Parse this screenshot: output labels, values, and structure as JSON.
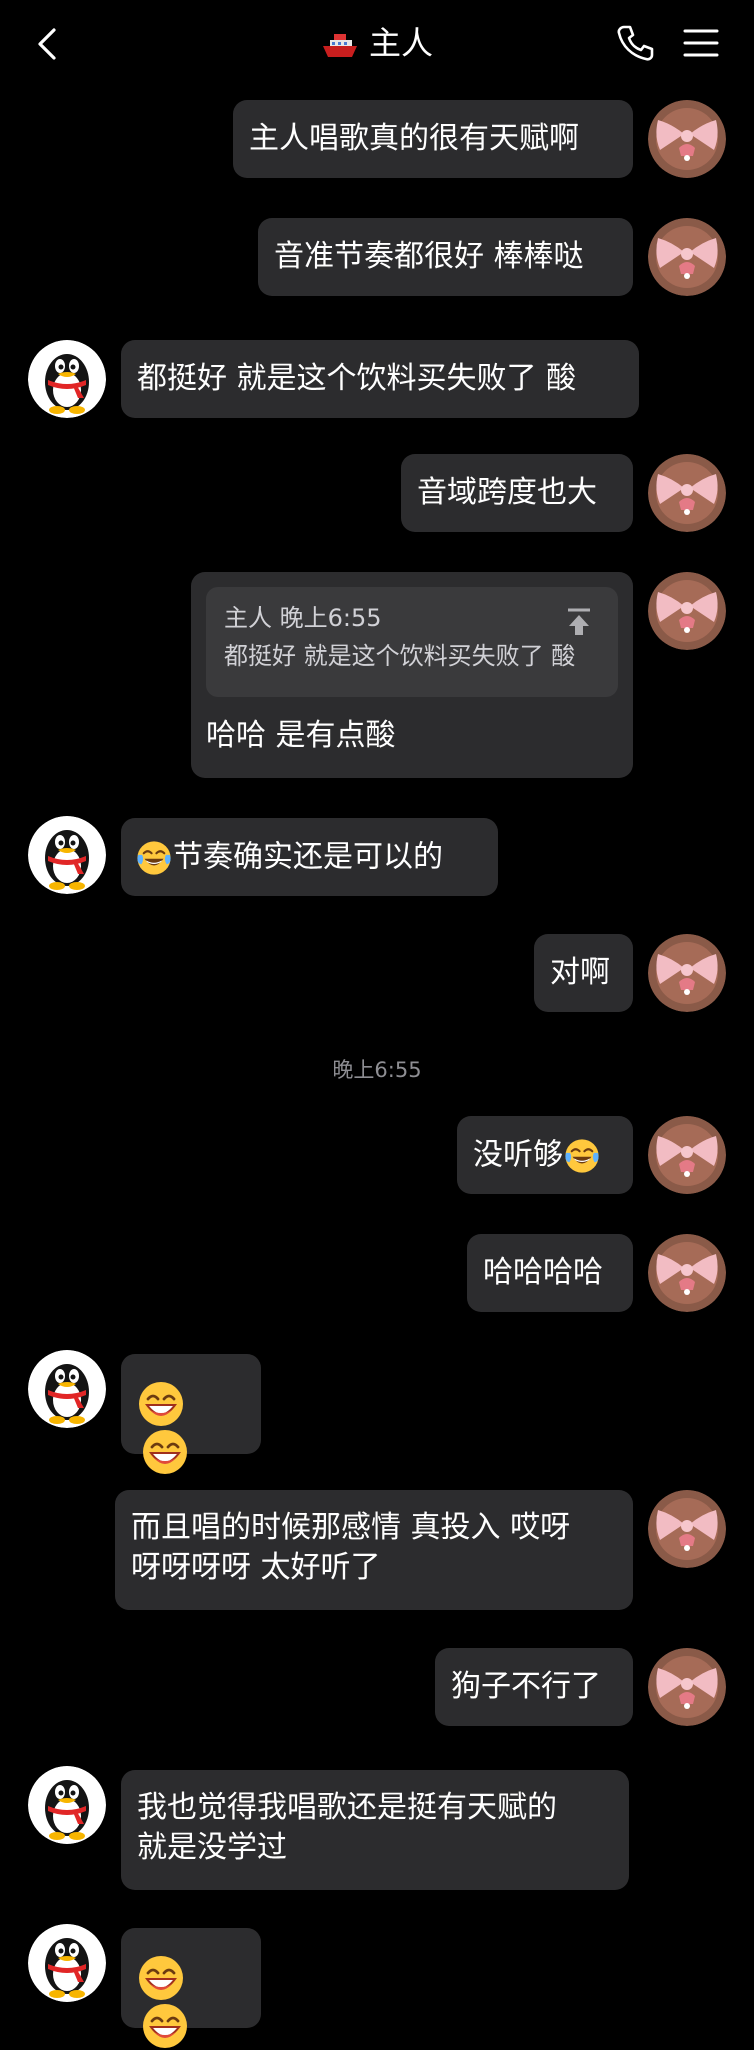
{
  "header": {
    "title": "主人",
    "back_icon": "chevron-left-icon",
    "title_icon": "ship-icon",
    "call_icon": "phone-icon",
    "menu_icon": "menu-icon"
  },
  "colors": {
    "background": "#000000",
    "bubble": "#2c2c2e",
    "quote_box": "#3a3a3c",
    "timestamp": "#8e8e93"
  },
  "messages": [
    {
      "side": "right",
      "text": "主人唱歌真的很有天赋啊"
    },
    {
      "side": "right",
      "text": "音准节奏都很好 棒棒哒"
    },
    {
      "side": "left",
      "text": "都挺好 就是这个饮料买失败了 酸"
    },
    {
      "side": "right",
      "text": "音域跨度也大"
    },
    {
      "side": "right",
      "quote_author": "主人 晚上6:55",
      "quote_text": "都挺好 就是这个饮料买失败了 酸",
      "text": "哈哈 是有点酸",
      "quote_icon": "pin-to-top-icon"
    },
    {
      "side": "left",
      "emoji": "laughing-tears-emoji",
      "text": "节奏确实还是可以的"
    },
    {
      "side": "right",
      "text": "对啊"
    },
    {
      "timestamp": "晚上6:55"
    },
    {
      "side": "right",
      "text": "没听够",
      "emoji": "laughing-tears-emoji"
    },
    {
      "side": "right",
      "text": "哈哈哈哈"
    },
    {
      "side": "left",
      "emojis": [
        "grin-emoji",
        "grin-emoji"
      ]
    },
    {
      "side": "right",
      "text_line1": "而且唱的时候那感情 真投入 哎呀",
      "text_line2": "呀呀呀呀 太好听了"
    },
    {
      "side": "right",
      "text": "狗子不行了"
    },
    {
      "side": "left",
      "text_line1": "我也觉得我唱歌还是挺有天赋的",
      "text_line2": "就是没学过"
    },
    {
      "side": "left",
      "emojis": [
        "grin-emoji",
        "grin-emoji"
      ]
    }
  ]
}
